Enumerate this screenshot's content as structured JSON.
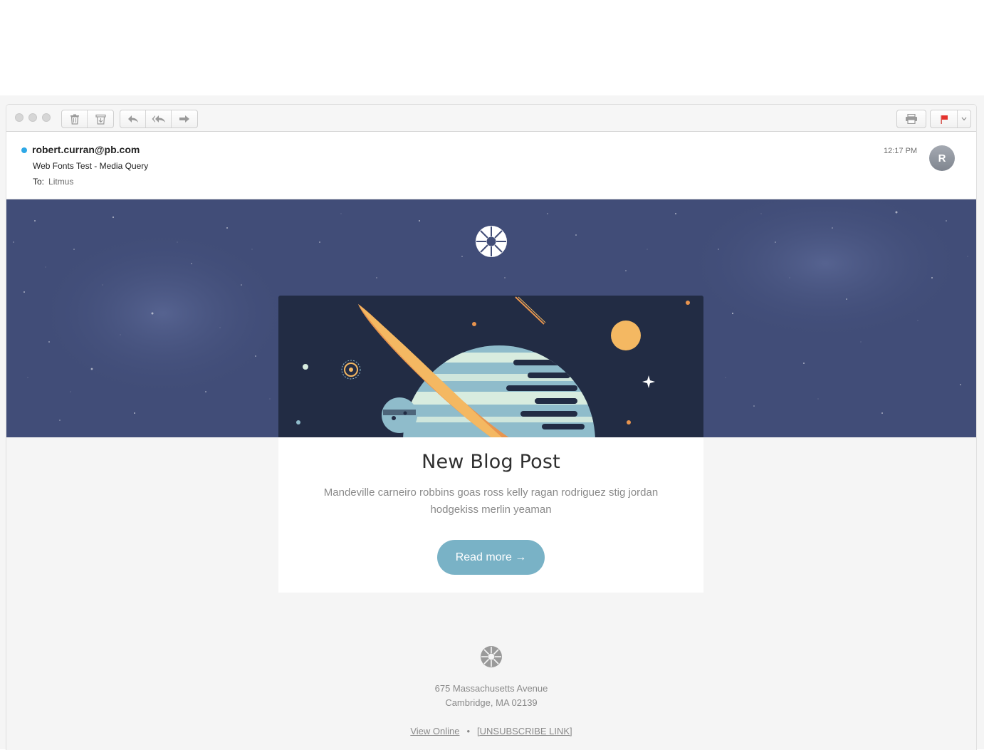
{
  "toolbar": {
    "traffic_lights": [
      "close",
      "minimize",
      "zoom"
    ],
    "left_icons": [
      "trash-icon",
      "archive-icon"
    ],
    "nav_icons": [
      "reply-icon",
      "reply-all-icon",
      "forward-icon"
    ],
    "right_icons": [
      "print-icon",
      "flag-icon",
      "chevron-down-icon"
    ],
    "flag_color": "#e5322d"
  },
  "message": {
    "sender": "robert.curran@pb.com",
    "subject": "Web Fonts Test - Media Query",
    "to_label": "To:",
    "to_value": "Litmus",
    "time": "12:17 PM",
    "avatar_initial": "R",
    "unread_color": "#2ea8e6"
  },
  "email": {
    "hero_bg": "#414d78",
    "card": {
      "title": "New Blog Post",
      "text": "Mandeville carneiro robbins goas ross kelly ragan rodriguez stig jordan hodgekiss merlin yeaman",
      "button_label": "Read more →",
      "button_color": "#79b2c6"
    },
    "footer": {
      "address_line1": "675 Massachusetts Avenue",
      "address_line2": "Cambridge, MA 02139",
      "view_online": "View Online",
      "separator": "•",
      "unsubscribe": "[UNSUBSCRIBE LINK]"
    }
  }
}
